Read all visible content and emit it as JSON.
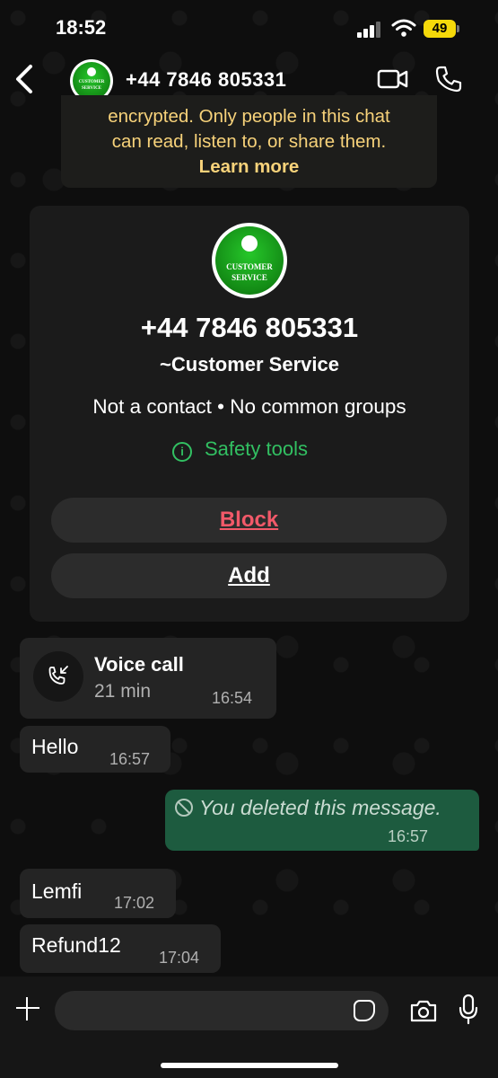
{
  "status_bar": {
    "time": "18:52",
    "battery": "49"
  },
  "header": {
    "title": "+44 7846 805331",
    "avatar_text_1": "CUSTOMER",
    "avatar_text_2": "SERVICE"
  },
  "encryption_notice": {
    "line1": "encrypted. Only people in this chat",
    "line2": "can read, listen to, or share them.",
    "link": "Learn more"
  },
  "info_card": {
    "number": "+44 7846 805331",
    "alias": "~Customer Service",
    "relation": "Not a contact • No common groups",
    "safety_tools": "Safety tools",
    "safety_icon_glyph": "i",
    "block_label": "Block",
    "add_label": "Add"
  },
  "messages": {
    "call": {
      "title": "Voice call",
      "duration": "21 min",
      "time": "16:54"
    },
    "hello": {
      "text": "Hello",
      "time": "16:57"
    },
    "deleted": {
      "text": "You deleted this message.",
      "time": "16:57"
    },
    "lemfi": {
      "text": "Lemfi",
      "time": "17:02"
    },
    "refund": {
      "text": "Refund12",
      "time": "17:04"
    }
  },
  "composer": {
    "placeholder": ""
  },
  "colors": {
    "accent_green": "#32c062",
    "block_red": "#f25969",
    "notice_yellow": "#f7d27a",
    "outgoing_bubble": "#1d5b3f"
  }
}
